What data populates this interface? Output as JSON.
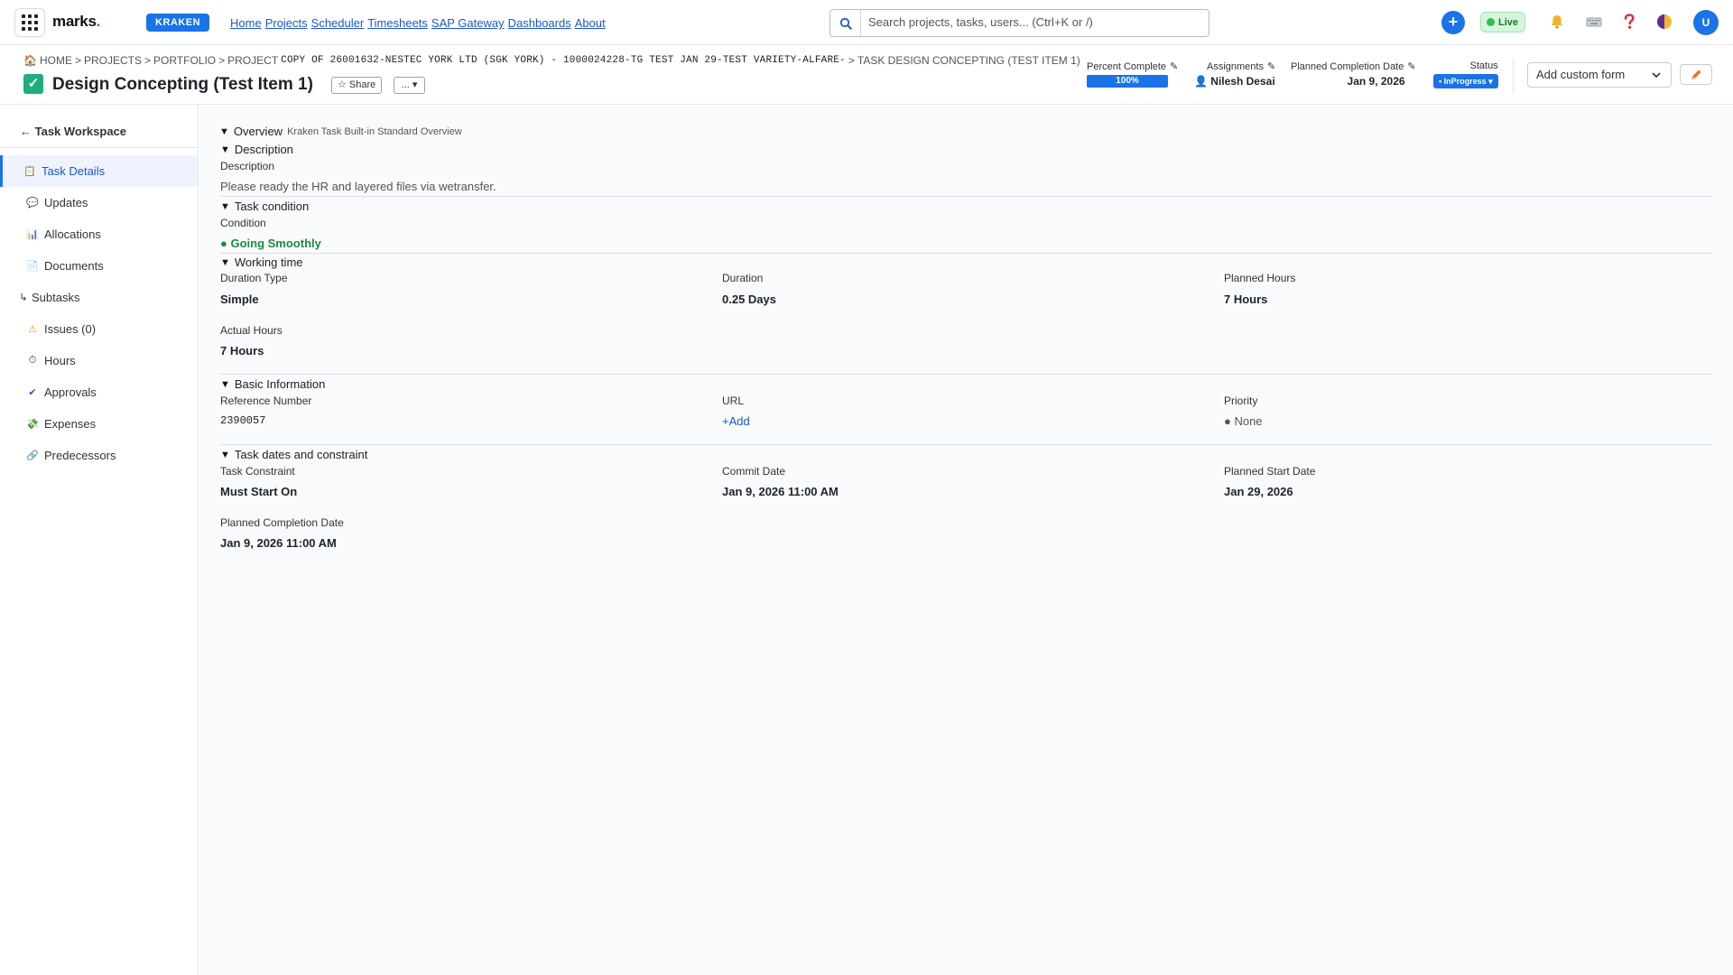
{
  "nav": {
    "logo_text": "marks",
    "logo_dot": ".",
    "brand_badge": "KRAKEN",
    "menu": [
      "Home",
      "Projects",
      "Scheduler",
      "Timesheets",
      "SAP Gateway",
      "Dashboards",
      "About"
    ],
    "search_placeholder": "Search projects, tasks, users... (Ctrl+K or /)",
    "plus_label": "+",
    "live_label": "Live",
    "avatar_initial": "U"
  },
  "header": {
    "breadcrumb": {
      "home": "HOME",
      "projects": "PROJECTS",
      "portfolio": "PORTFOLIO",
      "project_prefix": "PROJECT",
      "project_name": "COPY OF 26001632-NESTEC YORK LTD (SGK YORK) - 1000024228-TG TEST JAN 29-TEST VARIETY-ALFARE-",
      "task": "TASK DESIGN CONCEPTING (TEST ITEM 1)",
      "sep": ">"
    },
    "title": "Design Concepting (Test Item 1)",
    "share_label": "☆ Share",
    "more_label": "... ▾",
    "percent_complete": {
      "label": "Percent Complete",
      "value": 100,
      "text": "100%"
    },
    "assignments": {
      "label": "Assignments",
      "value": "Nilesh Desai"
    },
    "planned_completion": {
      "label": "Planned Completion Date",
      "value": "Jan 9, 2026"
    },
    "status": {
      "label": "Status",
      "value": "• InProgress ▾"
    },
    "custom_form_label": "Add custom form"
  },
  "sidebar": {
    "back_label": "← Task Workspace",
    "items": [
      {
        "label": "Task Details",
        "icon": "📋",
        "active": true
      },
      {
        "label": "Updates",
        "icon": "💬"
      },
      {
        "label": "Allocations",
        "icon": "📊"
      },
      {
        "label": "Documents",
        "icon": "📄"
      },
      {
        "label": "Subtasks",
        "icon": "↳"
      },
      {
        "label": "Issues (0)",
        "icon": "⚠"
      },
      {
        "label": "Hours",
        "icon": "⏱"
      },
      {
        "label": "Approvals",
        "icon": "✔"
      },
      {
        "label": "Expenses",
        "icon": "💸"
      },
      {
        "label": "Predecessors",
        "icon": "🔗"
      }
    ]
  },
  "main": {
    "overview": {
      "title": "Overview",
      "subtitle": "Kraken Task Built-in Standard Overview"
    },
    "description": {
      "title": "Description",
      "field_label": "Description",
      "value": "Please ready the HR and layered files via wetransfer."
    },
    "condition": {
      "title": "Task condition",
      "field_label": "Condition",
      "value": "● Going Smoothly"
    },
    "working_time": {
      "title": "Working time",
      "duration_type_label": "Duration Type",
      "duration_type": "Simple",
      "duration_label": "Duration",
      "duration": "0.25 Days",
      "planned_hours_label": "Planned Hours",
      "planned_hours": "7 Hours",
      "actual_hours_label": "Actual Hours",
      "actual_hours": "7 Hours"
    },
    "basic_info": {
      "title": "Basic Information",
      "ref_label": "Reference Number",
      "ref": "2390057",
      "url_label": "URL",
      "url": "+Add",
      "priority_label": "Priority",
      "priority": "● None"
    },
    "dates": {
      "title": "Task dates and constraint",
      "constraint_label": "Task Constraint",
      "constraint": "Must Start On",
      "commit_label": "Commit Date",
      "commit": "Jan 9, 2026 11:00 AM",
      "planned_start_label": "Planned Start Date",
      "planned_start": "Jan 29, 2026",
      "planned_completion_label": "Planned Completion Date",
      "planned_completion": "Jan 9, 2026 11:00 AM"
    },
    "triangle": "▼"
  },
  "colors": {
    "accent": "#1a73e8",
    "success": "#1e8a3d",
    "check_green": "#1fae7c"
  }
}
